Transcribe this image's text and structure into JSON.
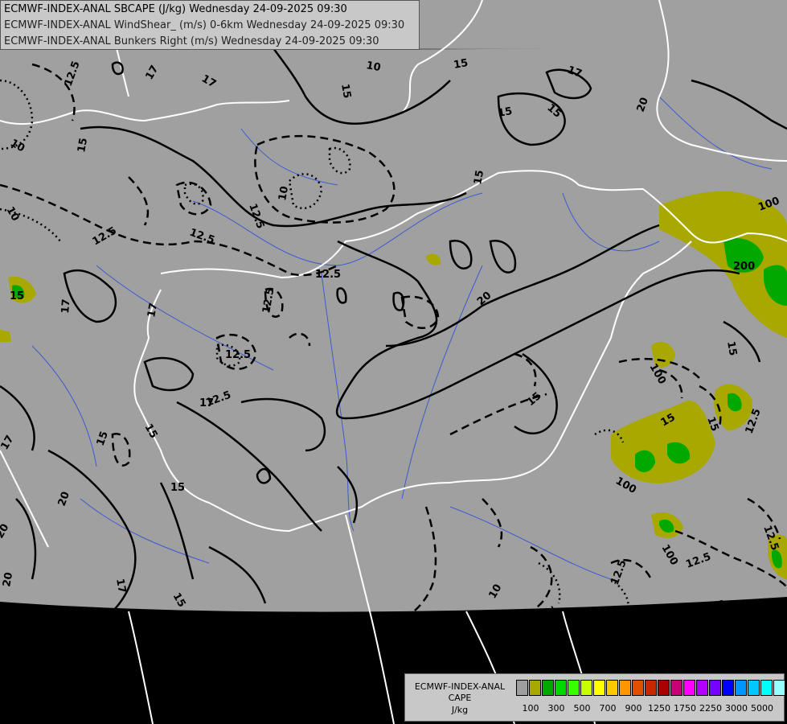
{
  "header": {
    "line1": "ECMWF-INDEX-ANAL SBCAPE (J/kg) Wednesday 24-09-2025 09:30",
    "line2": "ECMWF-INDEX-ANAL WindShear_ (m/s) 0-6km Wednesday 24-09-2025 09:30",
    "line3": "ECMWF-INDEX-ANAL Bunkers Right (m/s) Wednesday 24-09-2025 09:30"
  },
  "legend": {
    "line1": "ECMWF-INDEX-ANAL",
    "line2": "CAPE",
    "line3": "J/kg",
    "colors": [
      "#9e9e9e",
      "#a8a800",
      "#00a800",
      "#00d800",
      "#38ff00",
      "#c8ff00",
      "#ffff00",
      "#ffc800",
      "#ff9600",
      "#e05000",
      "#c82800",
      "#aa0000",
      "#c80078",
      "#ff00ff",
      "#b400ff",
      "#7800ff",
      "#0000ff",
      "#0096ff",
      "#00c8ff",
      "#00ffff",
      "#96ffff",
      "#ffffff"
    ],
    "ticks": [
      "100",
      "300",
      "500",
      "700",
      "900",
      "1250",
      "1750",
      "2250",
      "3000",
      "5000"
    ]
  },
  "contour_labels": [
    "12.5",
    "17",
    "17",
    "15",
    "15",
    "15",
    "17",
    "20",
    "12.5",
    "10",
    "10",
    "12.5",
    "12.5",
    "12.5",
    "12.5",
    "17",
    "17",
    "10",
    "12.5",
    "12.5",
    "15",
    "15",
    "20",
    "15",
    "200",
    "100",
    "100",
    "12.5",
    "100",
    "15",
    "20",
    "17",
    "15",
    "15",
    "20",
    "20",
    "17",
    "15",
    "12.5",
    "10",
    "10",
    "12.5",
    "15",
    "12.5",
    "10",
    "15",
    "15",
    "15",
    "100",
    "12.5",
    "15",
    "17"
  ],
  "map": {
    "land_color": "#a0a0a0",
    "outside_color": "#000000",
    "border_color": "#ffffff",
    "river_color": "#3c5ad2",
    "contour_color": "#000000"
  }
}
